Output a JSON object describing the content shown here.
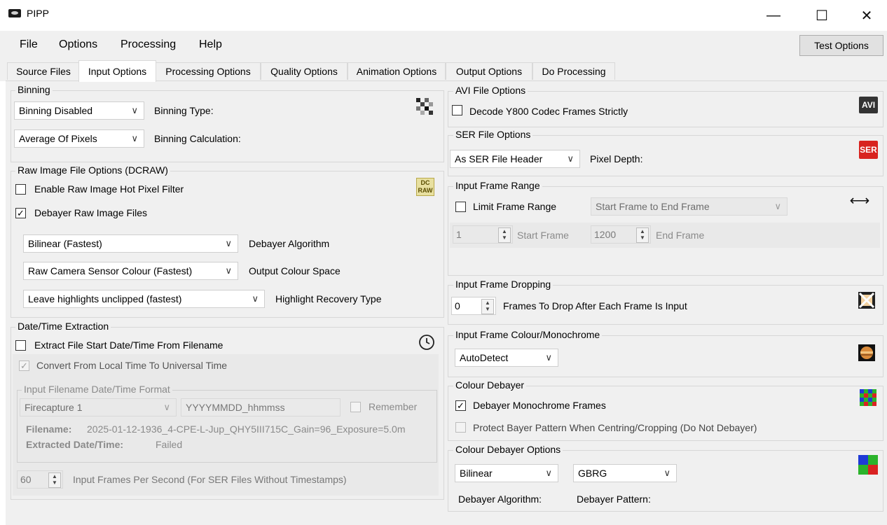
{
  "window": {
    "title": "PIPP",
    "minimize": "—",
    "maximize": "☐",
    "close": "✕"
  },
  "menu": {
    "file": "File",
    "options": "Options",
    "processing": "Processing",
    "help": "Help",
    "test_options": "Test Options"
  },
  "tabs": [
    "Source Files",
    "Input Options",
    "Processing Options",
    "Quality Options",
    "Animation Options",
    "Output Options",
    "Do Processing"
  ],
  "active_tab": "Input Options",
  "binning": {
    "title": "Binning",
    "type_value": "Binning Disabled",
    "type_label": "Binning Type:",
    "calc_value": "Average Of Pixels",
    "calc_label": "Binning Calculation:"
  },
  "raw": {
    "title": "Raw Image File Options (DCRAW)",
    "hot_pixel_label": "Enable Raw Image Hot Pixel Filter",
    "hot_pixel_checked": false,
    "debayer_label": "Debayer Raw Image Files",
    "debayer_checked": true,
    "algorithm_value": "Bilinear (Fastest)",
    "algorithm_label": "Debayer Algorithm",
    "colour_value": "Raw Camera Sensor Colour (Fastest)",
    "colour_label": "Output Colour Space",
    "highlight_value": "Leave highlights unclipped (fastest)",
    "highlight_label": "Highlight Recovery Type",
    "icon_text": "DC\nRAW"
  },
  "datetime": {
    "title": "Date/Time Extraction",
    "extract_label": "Extract File Start Date/Time From Filename",
    "extract_checked": false,
    "convert_label": "Convert From Local Time To Universal Time",
    "convert_checked": true,
    "format_title": "Input Filename Date/Time Format",
    "format_value": "Firecapture 1",
    "format_pattern": "YYYYMMDD_hhmmss",
    "remember_label": "Remember",
    "filename_key": "Filename:",
    "filename_value": "2025-01-12-1936_4-CPE-L-Jup_QHY5III715C_Gain=96_Exposure=5.0m",
    "extracted_key": "Extracted Date/Time:",
    "extracted_value": "Failed",
    "fps_value": "60",
    "fps_label": "Input Frames Per Second (For SER Files Without Timestamps)"
  },
  "avi": {
    "title": "AVI File Options",
    "decode_label": "Decode Y800 Codec Frames Strictly",
    "decode_checked": false,
    "icon_text": "AVI"
  },
  "ser": {
    "title": "SER File Options",
    "depth_value": "As SER File Header",
    "depth_label": "Pixel Depth:",
    "icon_text": "SER"
  },
  "frame_range": {
    "title": "Input Frame Range",
    "limit_label": "Limit Frame Range",
    "limit_checked": false,
    "mode_value": "Start Frame to End Frame",
    "start_value": "1",
    "start_label": "Start Frame",
    "end_value": "1200",
    "end_label": "End Frame",
    "icon_text": "⟷"
  },
  "dropping": {
    "title": "Input Frame Dropping",
    "value": "0",
    "label": "Frames To Drop After Each Frame Is Input"
  },
  "colour_mono": {
    "title": "Input Frame Colour/Monochrome",
    "value": "AutoDetect"
  },
  "colour_debayer": {
    "title": "Colour Debayer",
    "mono_label": "Debayer Monochrome Frames",
    "mono_checked": true,
    "protect_label": "Protect Bayer Pattern When Centring/Cropping (Do Not Debayer)",
    "protect_checked": false
  },
  "debayer_options": {
    "title": "Colour Debayer Options",
    "algorithm_value": "Bilinear",
    "algorithm_label": "Debayer Algorithm:",
    "pattern_value": "GBRG",
    "pattern_label": "Debayer Pattern:"
  },
  "icons": {
    "chevron": "∨",
    "check": "✓",
    "spin_up": "▲",
    "spin_down": "▼"
  }
}
